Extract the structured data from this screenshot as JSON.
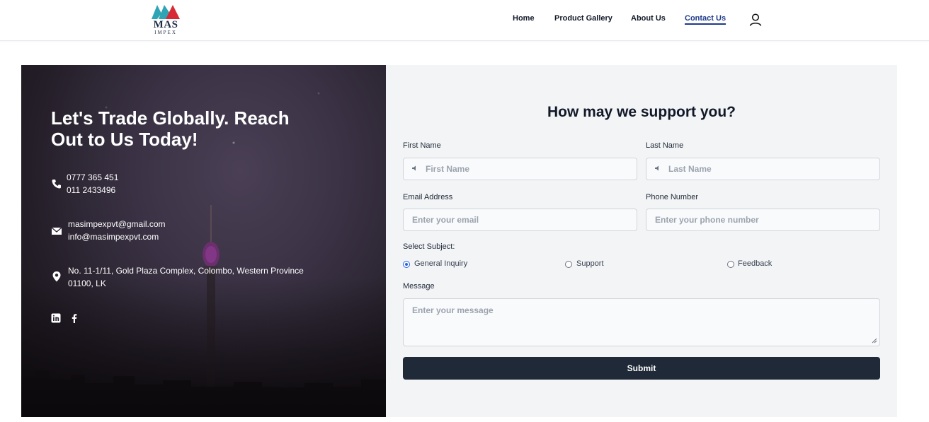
{
  "header": {
    "logo_text": "MAS",
    "logo_sub": "IMPEX",
    "nav": [
      {
        "label": "Home"
      },
      {
        "label": "Product Gallery"
      },
      {
        "label": "About Us"
      },
      {
        "label": "Contact Us",
        "active": true
      }
    ],
    "account_icon": "user-icon"
  },
  "hero": {
    "title": "Let's Trade Globally. Reach Out to Us Today!",
    "phone_1": "0777 365 451",
    "phone_2": "011 2433496",
    "email_1": "masimpexpvt@gmail.com",
    "email_2": "info@masimpexpvt.com",
    "address_1": "No. 11-1/11, Gold Plaza Complex, Colombo, Western Province",
    "address_2": "01100, LK",
    "icons": [
      "phone-icon",
      "mail-icon",
      "location-pin-icon",
      "linkedin-icon",
      "facebook-icon"
    ]
  },
  "form": {
    "title": "How may we support you?",
    "first_name_label": "First Name",
    "first_name_placeholder": "First Name",
    "first_name_value": "",
    "last_name_label": "Last Name",
    "last_name_placeholder": "Last Name",
    "last_name_value": "",
    "email_label": "Email Address",
    "email_placeholder": "Enter your email",
    "email_value": "",
    "phone_label": "Phone Number",
    "phone_placeholder": "Enter your phone number",
    "phone_value": "",
    "subject_label": "Select Subject:",
    "subjects": [
      {
        "label": "General Inquiry",
        "selected": true
      },
      {
        "label": "Support",
        "selected": false
      },
      {
        "label": "Feedback",
        "selected": false
      }
    ],
    "message_label": "Message",
    "message_placeholder": "Enter your message",
    "message_value": "",
    "submit_label": "Submit"
  },
  "colors": {
    "primary_dark": "#1f2937",
    "nav_active": "#1e3a8a",
    "radio_selected": "#2563eb",
    "form_bg": "#f3f4f6",
    "logo_teal": "#2fa4b5",
    "logo_red": "#d62b35"
  }
}
